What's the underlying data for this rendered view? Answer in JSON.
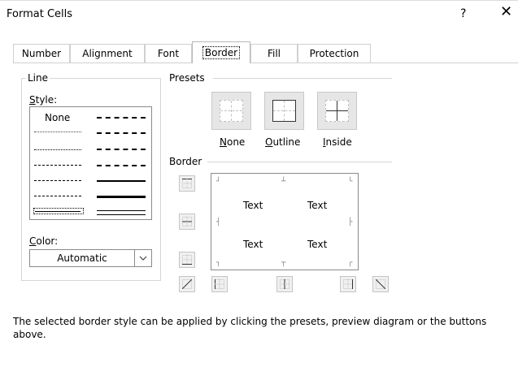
{
  "window": {
    "title": "Format Cells",
    "help": "?",
    "close": "✕"
  },
  "tabs": [
    {
      "label": "Number"
    },
    {
      "label": "Alignment"
    },
    {
      "label": "Font"
    },
    {
      "label": "Border",
      "active": true
    },
    {
      "label": "Fill"
    },
    {
      "label": "Protection"
    }
  ],
  "line_group": {
    "legend": "Line",
    "style_label": "Style:",
    "none_label": "None",
    "color_label": "Color:",
    "color_value": "Automatic"
  },
  "presets": {
    "legend": "Presets",
    "buttons": [
      {
        "label": "None"
      },
      {
        "label": "Outline"
      },
      {
        "label": "Inside"
      }
    ]
  },
  "border": {
    "legend": "Border",
    "preview_texts": [
      "Text",
      "Text",
      "Text",
      "Text"
    ]
  },
  "note": "The selected border style can be applied by clicking the presets, preview diagram or the buttons above.",
  "colors": {
    "accent_border": "#8a8a8a",
    "button_face": "#e6e6e6"
  },
  "icons": [
    "help-icon",
    "close-icon",
    "chevron-down-icon"
  ]
}
